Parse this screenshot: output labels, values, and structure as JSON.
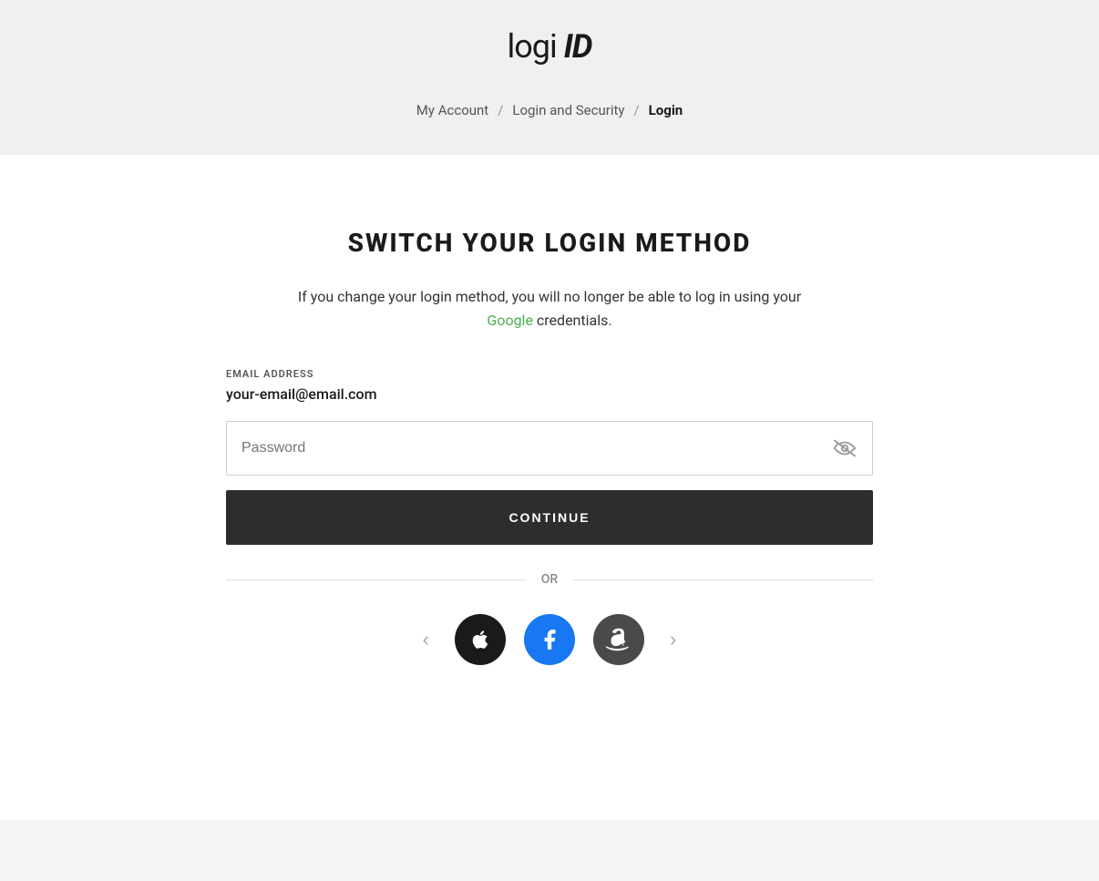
{
  "header": {
    "logo_logi": "logi",
    "logo_id": "ID"
  },
  "breadcrumb": {
    "my_account": "My Account",
    "separator1": "/",
    "login_security": "Login and Security",
    "separator2": "/",
    "current": "Login"
  },
  "main": {
    "title": "SWITCH YOUR LOGIN METHOD",
    "description_part1": "If you change your login method, you will no longer be able to log in using your",
    "google_text": "Google",
    "description_part2": "credentials.",
    "email_label": "EMAIL ADDRESS",
    "email_value": "your-email@email.com",
    "password_placeholder": "Password",
    "continue_label": "CONTINUE",
    "or_text": "OR"
  },
  "social": {
    "prev_label": "‹",
    "next_label": "›"
  }
}
